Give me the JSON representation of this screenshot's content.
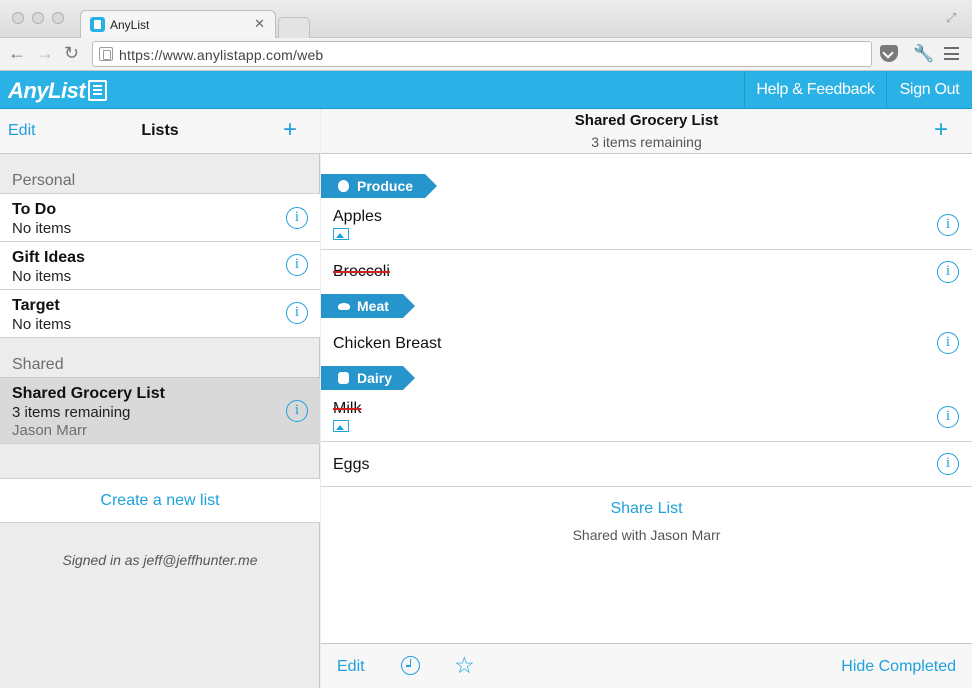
{
  "browser": {
    "tab_title": "AnyList",
    "tab_close": "✕",
    "url": "https://www.anylistapp.com/web"
  },
  "app": {
    "logo": "AnyList",
    "help_button": "Help & Feedback",
    "signout_button": "Sign Out"
  },
  "left": {
    "edit": "Edit",
    "title": "Lists",
    "add": "+",
    "sections": {
      "personal": "Personal",
      "shared": "Shared"
    },
    "lists": [
      {
        "name": "To Do",
        "sub": "No items"
      },
      {
        "name": "Gift Ideas",
        "sub": "No items"
      },
      {
        "name": "Target",
        "sub": "No items"
      },
      {
        "name": "Shared Grocery List",
        "sub": "3 items remaining",
        "owner": "Jason Marr"
      }
    ],
    "create": "Create a new list",
    "signed_in": "Signed in as jeff@jeffhunter.me"
  },
  "right": {
    "title": "Shared Grocery List",
    "subtitle": "3 items remaining",
    "add": "+",
    "categories": {
      "produce": "Produce",
      "meat": "Meat",
      "dairy": "Dairy"
    },
    "items": {
      "apples": "Apples",
      "broccoli": "Broccoli",
      "chicken": "Chicken Breast",
      "milk": "Milk",
      "eggs": "Eggs"
    },
    "share_link": "Share List",
    "share_sub": "Shared with Jason Marr",
    "bottom": {
      "edit": "Edit",
      "hide_completed": "Hide Completed"
    }
  },
  "icons": {
    "info": "i",
    "star": "☆",
    "wrench": "🔧"
  },
  "colors": {
    "accent": "#1ea1dc",
    "header": "#2ab1e6",
    "category": "#2595cc",
    "strike": "#d32020"
  }
}
